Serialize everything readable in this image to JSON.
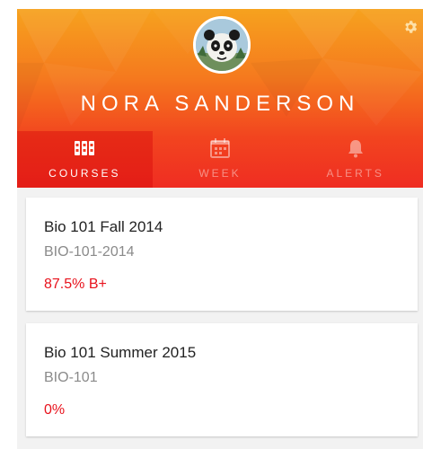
{
  "user": {
    "name": "NORA SANDERSON"
  },
  "icons": {
    "settings": "gear-icon",
    "courses": "books-icon",
    "week": "calendar-icon",
    "alerts": "bell-icon"
  },
  "colors": {
    "header_top": "#f6a21e",
    "header_bottom": "#ef2d22",
    "grade": "#e8121c"
  },
  "tabs": [
    {
      "label": "COURSES",
      "active": true
    },
    {
      "label": "WEEK",
      "active": false
    },
    {
      "label": "ALERTS",
      "active": false
    }
  ],
  "courses": [
    {
      "title": "Bio 101 Fall 2014",
      "code": "BIO-101-2014",
      "grade": "87.5%  B+"
    },
    {
      "title": "Bio 101 Summer 2015",
      "code": "BIO-101",
      "grade": "0%"
    }
  ]
}
